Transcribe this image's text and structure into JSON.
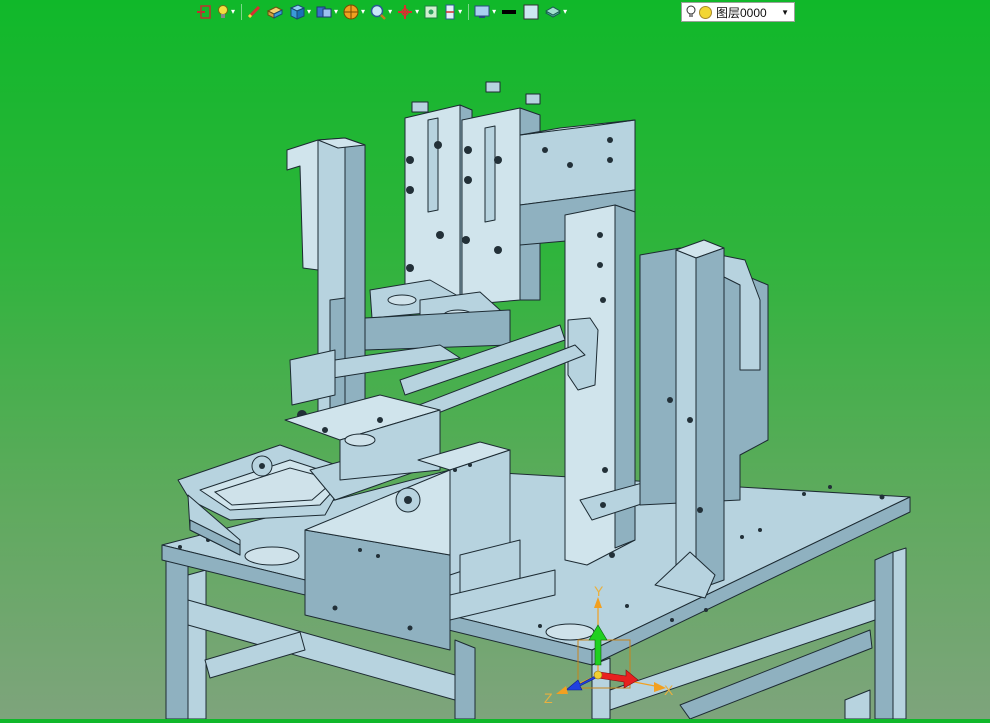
{
  "toolbar": {
    "buttons": [
      {
        "icon": "exit-sketch-icon",
        "color": "#d03030"
      },
      {
        "icon": "light-bulb-icon",
        "color": "#f2e040"
      },
      {
        "icon": "pen-icon",
        "color": "#e04040"
      },
      {
        "icon": "solid-box-icon",
        "color": "#e8c050"
      },
      {
        "icon": "cube-view-icon",
        "color": "#3a9ad8"
      },
      {
        "icon": "views-icon",
        "color": "#3a70c8"
      },
      {
        "icon": "render-ball-icon",
        "color": "#f0a020"
      },
      {
        "icon": "zoom-icon",
        "color": "#4a9ad8"
      },
      {
        "icon": "pan-icon",
        "color": "#d83030"
      },
      {
        "icon": "fit-view-icon",
        "color": "#30a060"
      },
      {
        "icon": "section-icon",
        "color": "#d03030"
      },
      {
        "icon": "display-monitor-icon",
        "color": "#3a80c8"
      },
      {
        "icon": "line-color-icon",
        "color": "#000000"
      },
      {
        "icon": "face-color-icon",
        "color": "#cce8f0"
      },
      {
        "icon": "layer-stack-icon",
        "color": "#50b0a0"
      }
    ],
    "layer_combo": {
      "label": "图层0000"
    }
  },
  "triad": {
    "x_label": "X",
    "y_label": "Y",
    "z_label": "Z"
  },
  "colors": {
    "part_fill": "#b7d3df",
    "part_stroke": "#1d2b33",
    "bg_top": "#10b82a",
    "bg_bottom": "#7ea47c"
  }
}
